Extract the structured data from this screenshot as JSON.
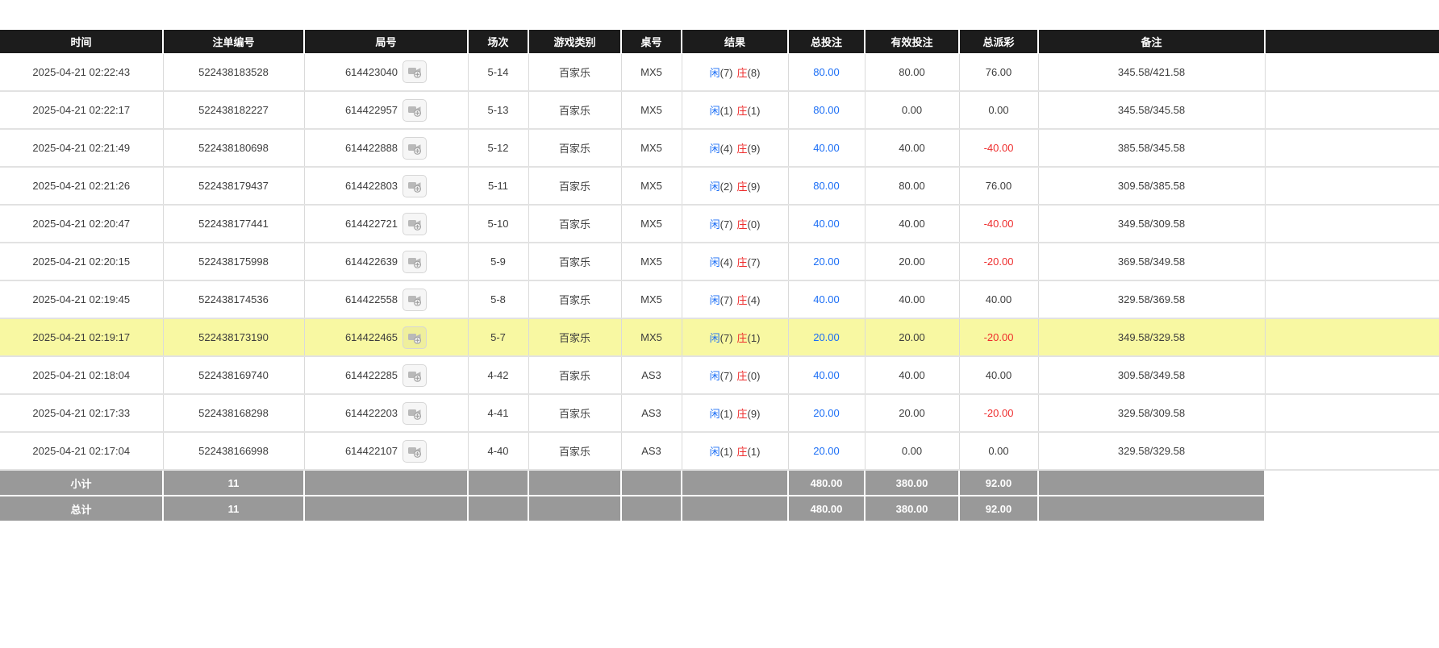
{
  "colors": {
    "header_bg": "#1c1c1c",
    "highlight_bg": "#f8f8a2",
    "summary_bg": "#999999",
    "accent_blue": "#1b6ef5",
    "accent_red": "#ee2d2d"
  },
  "icons": {
    "round_replay": "video-camera-icon"
  },
  "table": {
    "columns": [
      {
        "key": "time",
        "label": "时间"
      },
      {
        "key": "bet_no",
        "label": "注单编号"
      },
      {
        "key": "round_no",
        "label": "局号"
      },
      {
        "key": "session",
        "label": "场次"
      },
      {
        "key": "game_type",
        "label": "游戏类别"
      },
      {
        "key": "table_no",
        "label": "桌号"
      },
      {
        "key": "result",
        "label": "结果"
      },
      {
        "key": "total_bet",
        "label": "总投注"
      },
      {
        "key": "valid_bet",
        "label": "有效投注"
      },
      {
        "key": "total_payout",
        "label": "总派彩"
      },
      {
        "key": "remark",
        "label": "备注"
      }
    ],
    "rows": [
      {
        "time": "2025-04-21 02:22:43",
        "bet_no": "522438183528",
        "round_no": "614423040",
        "session": "5-14",
        "game_type": "百家乐",
        "table_no": "MX5",
        "result": {
          "player_label": "闲",
          "player_score": "(7)",
          "banker_label": "庄",
          "banker_score": "(8)"
        },
        "total_bet": "80.00",
        "valid_bet": "80.00",
        "total_payout": "76.00",
        "remark": "345.58/421.58",
        "highlight": false
      },
      {
        "time": "2025-04-21 02:22:17",
        "bet_no": "522438182227",
        "round_no": "614422957",
        "session": "5-13",
        "game_type": "百家乐",
        "table_no": "MX5",
        "result": {
          "player_label": "闲",
          "player_score": "(1)",
          "banker_label": "庄",
          "banker_score": "(1)"
        },
        "total_bet": "80.00",
        "valid_bet": "0.00",
        "total_payout": "0.00",
        "remark": "345.58/345.58",
        "highlight": false
      },
      {
        "time": "2025-04-21 02:21:49",
        "bet_no": "522438180698",
        "round_no": "614422888",
        "session": "5-12",
        "game_type": "百家乐",
        "table_no": "MX5",
        "result": {
          "player_label": "闲",
          "player_score": "(4)",
          "banker_label": "庄",
          "banker_score": "(9)"
        },
        "total_bet": "40.00",
        "valid_bet": "40.00",
        "total_payout": "-40.00",
        "remark": "385.58/345.58",
        "highlight": false
      },
      {
        "time": "2025-04-21 02:21:26",
        "bet_no": "522438179437",
        "round_no": "614422803",
        "session": "5-11",
        "game_type": "百家乐",
        "table_no": "MX5",
        "result": {
          "player_label": "闲",
          "player_score": "(2)",
          "banker_label": "庄",
          "banker_score": "(9)"
        },
        "total_bet": "80.00",
        "valid_bet": "80.00",
        "total_payout": "76.00",
        "remark": "309.58/385.58",
        "highlight": false
      },
      {
        "time": "2025-04-21 02:20:47",
        "bet_no": "522438177441",
        "round_no": "614422721",
        "session": "5-10",
        "game_type": "百家乐",
        "table_no": "MX5",
        "result": {
          "player_label": "闲",
          "player_score": "(7)",
          "banker_label": "庄",
          "banker_score": "(0)"
        },
        "total_bet": "40.00",
        "valid_bet": "40.00",
        "total_payout": "-40.00",
        "remark": "349.58/309.58",
        "highlight": false
      },
      {
        "time": "2025-04-21 02:20:15",
        "bet_no": "522438175998",
        "round_no": "614422639",
        "session": "5-9",
        "game_type": "百家乐",
        "table_no": "MX5",
        "result": {
          "player_label": "闲",
          "player_score": "(4)",
          "banker_label": "庄",
          "banker_score": "(7)"
        },
        "total_bet": "20.00",
        "valid_bet": "20.00",
        "total_payout": "-20.00",
        "remark": "369.58/349.58",
        "highlight": false
      },
      {
        "time": "2025-04-21 02:19:45",
        "bet_no": "522438174536",
        "round_no": "614422558",
        "session": "5-8",
        "game_type": "百家乐",
        "table_no": "MX5",
        "result": {
          "player_label": "闲",
          "player_score": "(7)",
          "banker_label": "庄",
          "banker_score": "(4)"
        },
        "total_bet": "40.00",
        "valid_bet": "40.00",
        "total_payout": "40.00",
        "remark": "329.58/369.58",
        "highlight": false
      },
      {
        "time": "2025-04-21 02:19:17",
        "bet_no": "522438173190",
        "round_no": "614422465",
        "session": "5-7",
        "game_type": "百家乐",
        "table_no": "MX5",
        "result": {
          "player_label": "闲",
          "player_score": "(7)",
          "banker_label": "庄",
          "banker_score": "(1)"
        },
        "total_bet": "20.00",
        "valid_bet": "20.00",
        "total_payout": "-20.00",
        "remark": "349.58/329.58",
        "highlight": true
      },
      {
        "time": "2025-04-21 02:18:04",
        "bet_no": "522438169740",
        "round_no": "614422285",
        "session": "4-42",
        "game_type": "百家乐",
        "table_no": "AS3",
        "result": {
          "player_label": "闲",
          "player_score": "(7)",
          "banker_label": "庄",
          "banker_score": "(0)"
        },
        "total_bet": "40.00",
        "valid_bet": "40.00",
        "total_payout": "40.00",
        "remark": "309.58/349.58",
        "highlight": false
      },
      {
        "time": "2025-04-21 02:17:33",
        "bet_no": "522438168298",
        "round_no": "614422203",
        "session": "4-41",
        "game_type": "百家乐",
        "table_no": "AS3",
        "result": {
          "player_label": "闲",
          "player_score": "(1)",
          "banker_label": "庄",
          "banker_score": "(9)"
        },
        "total_bet": "20.00",
        "valid_bet": "20.00",
        "total_payout": "-20.00",
        "remark": "329.58/309.58",
        "highlight": false
      },
      {
        "time": "2025-04-21 02:17:04",
        "bet_no": "522438166998",
        "round_no": "614422107",
        "session": "4-40",
        "game_type": "百家乐",
        "table_no": "AS3",
        "result": {
          "player_label": "闲",
          "player_score": "(1)",
          "banker_label": "庄",
          "banker_score": "(1)"
        },
        "total_bet": "20.00",
        "valid_bet": "0.00",
        "total_payout": "0.00",
        "remark": "329.58/329.58",
        "highlight": false
      }
    ],
    "summary_rows": [
      {
        "label": "小计",
        "count": "11",
        "total_bet": "480.00",
        "valid_bet": "380.00",
        "total_payout": "92.00"
      },
      {
        "label": "总计",
        "count": "11",
        "total_bet": "480.00",
        "valid_bet": "380.00",
        "total_payout": "92.00"
      }
    ]
  }
}
